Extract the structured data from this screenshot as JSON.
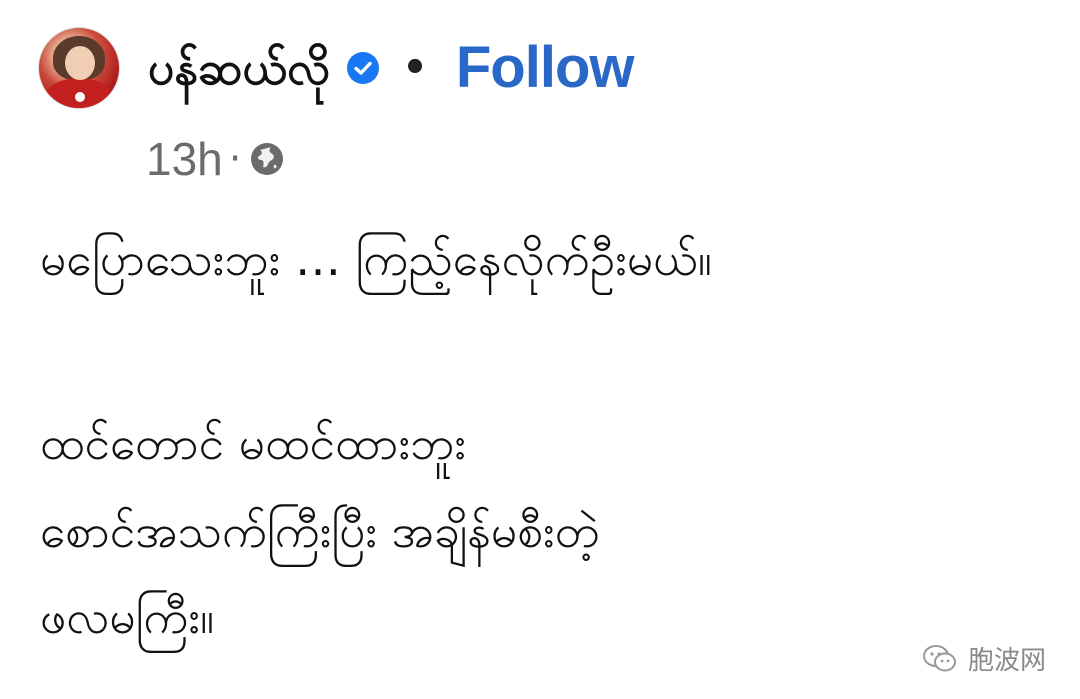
{
  "post": {
    "author": "ပန်ဆယ်လို",
    "separator": "•",
    "follow_label": "Follow",
    "time": "13h",
    "time_separator": "·",
    "audience_icon": "globe-icon",
    "verified_icon": "verified-badge-icon",
    "lines": [
      "မပြောသေးဘူး … ကြည့်နေလိုက်ဦးမယ်။",
      "ထင်တောင် မထင်ထားဘူး",
      "စောင်အသက်ကြီးပြီး အချိန်မစီးတဲ့",
      "ဖလမကြီး။"
    ]
  },
  "watermark": {
    "text": "胞波网",
    "icon": "wechat-logo-icon"
  },
  "colors": {
    "follow": "#2a68c8",
    "verified": "#1877f2",
    "meta": "#6b6b6b",
    "text": "#111111"
  }
}
